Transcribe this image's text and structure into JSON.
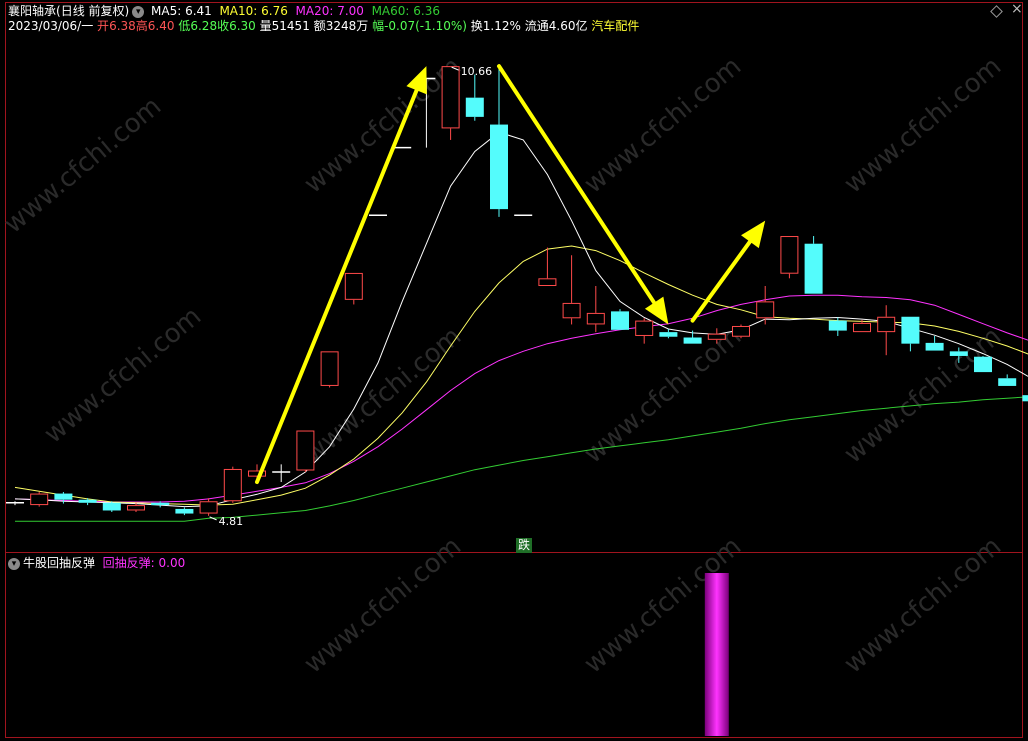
{
  "header": {
    "stock_name": "襄阳轴承",
    "period_label": "(日线 前复权)",
    "ma": [
      {
        "label": "MA5: 6.41",
        "color": "#ffffff"
      },
      {
        "label": "MA10: 6.76",
        "color": "#ffff33"
      },
      {
        "label": "MA20: 7.00",
        "color": "#ff33ff"
      },
      {
        "label": "MA60: 6.36",
        "color": "#33cc33"
      }
    ],
    "date": "2023/03/06/一",
    "open_label": "开",
    "open": "6.38",
    "high_label": "高",
    "high": "6.40",
    "low_label": "低",
    "low": "6.28",
    "close_label": "收",
    "close": "6.30",
    "volume_label": "量",
    "volume": "51451",
    "amount_label": "额",
    "amount": "3248万",
    "change_label": "幅",
    "change": "-0.07(-1.10%)",
    "turnover_label": "换",
    "turnover": "1.12%",
    "float_label": "流通",
    "float_value": "4.60亿",
    "industry": "汽车配件"
  },
  "annotations": {
    "high_marker": "10.66",
    "low_marker": "4.81",
    "signal_label": "跌",
    "watermark": "www.cfchi.com"
  },
  "indicator": {
    "name": "牛股回抽反弹",
    "series_label": "回抽反弹: 0.00",
    "series_color": "#ff33ff"
  },
  "chart_data": {
    "type": "candlestick",
    "price_range": [
      4.6,
      11.0
    ],
    "candles": [
      {
        "o": 4.98,
        "h": 5.0,
        "l": 4.95,
        "c": 4.98
      },
      {
        "o": 4.95,
        "h": 5.12,
        "l": 4.93,
        "c": 5.1
      },
      {
        "o": 5.1,
        "h": 5.12,
        "l": 4.97,
        "c": 5.02
      },
      {
        "o": 5.02,
        "h": 5.04,
        "l": 4.95,
        "c": 4.98
      },
      {
        "o": 4.98,
        "h": 5.0,
        "l": 4.86,
        "c": 4.88
      },
      {
        "o": 4.88,
        "h": 4.98,
        "l": 4.86,
        "c": 4.95
      },
      {
        "o": 4.98,
        "h": 5.0,
        "l": 4.92,
        "c": 4.95
      },
      {
        "o": 4.9,
        "h": 4.92,
        "l": 4.82,
        "c": 4.84
      },
      {
        "o": 4.84,
        "h": 5.04,
        "l": 4.81,
        "c": 5.0
      },
      {
        "o": 5.0,
        "h": 5.45,
        "l": 4.98,
        "c": 5.42
      },
      {
        "o": 5.32,
        "h": 5.48,
        "l": 5.25,
        "c": 5.4
      },
      {
        "o": 5.38,
        "h": 5.48,
        "l": 5.25,
        "c": 5.38
      },
      {
        "o": 5.4,
        "h": 5.92,
        "l": 5.38,
        "c": 5.92
      },
      {
        "o": 6.5,
        "h": 6.95,
        "l": 6.48,
        "c": 6.95
      },
      {
        "o": 7.62,
        "h": 7.97,
        "l": 7.56,
        "c": 7.97
      },
      {
        "o": 8.72,
        "h": 8.72,
        "l": 8.72,
        "c": 8.72
      },
      {
        "o": 9.6,
        "h": 9.6,
        "l": 9.6,
        "c": 9.6
      },
      {
        "o": 10.5,
        "h": 10.5,
        "l": 9.6,
        "c": 10.5
      },
      {
        "o": 9.85,
        "h": 10.66,
        "l": 9.7,
        "c": 10.66
      },
      {
        "o": 10.25,
        "h": 10.55,
        "l": 9.95,
        "c": 10.0
      },
      {
        "o": 9.9,
        "h": 10.66,
        "l": 8.7,
        "c": 8.8
      },
      {
        "o": 8.72,
        "h": 8.72,
        "l": 8.72,
        "c": 8.72
      },
      {
        "o": 7.8,
        "h": 8.3,
        "l": 7.8,
        "c": 7.9
      },
      {
        "o": 7.38,
        "h": 8.2,
        "l": 7.3,
        "c": 7.58
      },
      {
        "o": 7.3,
        "h": 7.8,
        "l": 7.2,
        "c": 7.45
      },
      {
        "o": 7.47,
        "h": 7.5,
        "l": 7.24,
        "c": 7.23
      },
      {
        "o": 7.15,
        "h": 7.38,
        "l": 7.05,
        "c": 7.35
      },
      {
        "o": 7.2,
        "h": 7.24,
        "l": 7.12,
        "c": 7.14
      },
      {
        "o": 7.13,
        "h": 7.22,
        "l": 7.05,
        "c": 7.05
      },
      {
        "o": 7.1,
        "h": 7.25,
        "l": 7.05,
        "c": 7.18
      },
      {
        "o": 7.14,
        "h": 7.3,
        "l": 7.12,
        "c": 7.28
      },
      {
        "o": 7.38,
        "h": 7.8,
        "l": 7.3,
        "c": 7.6
      },
      {
        "o": 7.96,
        "h": 8.45,
        "l": 7.9,
        "c": 8.45
      },
      {
        "o": 8.35,
        "h": 8.45,
        "l": 7.7,
        "c": 7.7
      },
      {
        "o": 7.35,
        "h": 7.39,
        "l": 7.15,
        "c": 7.22
      },
      {
        "o": 7.2,
        "h": 7.36,
        "l": 7.2,
        "c": 7.32
      },
      {
        "o": 7.2,
        "h": 7.55,
        "l": 6.9,
        "c": 7.4
      },
      {
        "o": 7.4,
        "h": 7.4,
        "l": 6.95,
        "c": 7.05
      },
      {
        "o": 7.06,
        "h": 7.15,
        "l": 6.96,
        "c": 6.96
      },
      {
        "o": 6.95,
        "h": 7.0,
        "l": 6.8,
        "c": 6.89
      },
      {
        "o": 6.88,
        "h": 6.89,
        "l": 6.68,
        "c": 6.68
      },
      {
        "o": 6.6,
        "h": 6.65,
        "l": 6.5,
        "c": 6.5
      },
      {
        "o": 6.38,
        "h": 6.4,
        "l": 6.28,
        "c": 6.3
      }
    ],
    "ma5": [
      5.03,
      5.02,
      5.0,
      4.99,
      4.98,
      4.97,
      4.95,
      4.93,
      4.94,
      5.02,
      5.09,
      5.18,
      5.38,
      5.71,
      6.2,
      6.8,
      7.6,
      8.35,
      9.1,
      9.55,
      9.8,
      9.7,
      9.25,
      8.65,
      8.0,
      7.6,
      7.39,
      7.24,
      7.19,
      7.17,
      7.23,
      7.37,
      7.36,
      7.38,
      7.39,
      7.37,
      7.34,
      7.25,
      7.16,
      7.05,
      6.92,
      6.78,
      6.6
    ],
    "ma10": [
      5.18,
      5.13,
      5.08,
      5.03,
      4.99,
      4.98,
      4.97,
      4.96,
      4.95,
      4.96,
      5.02,
      5.08,
      5.17,
      5.34,
      5.55,
      5.82,
      6.15,
      6.55,
      7.02,
      7.47,
      7.84,
      8.12,
      8.28,
      8.32,
      8.26,
      8.13,
      7.97,
      7.82,
      7.68,
      7.56,
      7.49,
      7.4,
      7.38,
      7.37,
      7.35,
      7.34,
      7.33,
      7.32,
      7.28,
      7.21,
      7.12,
      7.02,
      6.9
    ],
    "ma20": [
      5.03,
      5.02,
      5.01,
      5.0,
      4.99,
      4.99,
      4.99,
      5.0,
      5.03,
      5.08,
      5.13,
      5.18,
      5.24,
      5.36,
      5.52,
      5.71,
      5.94,
      6.19,
      6.44,
      6.66,
      6.83,
      6.95,
      7.05,
      7.12,
      7.18,
      7.23,
      7.27,
      7.31,
      7.38,
      7.48,
      7.56,
      7.62,
      7.67,
      7.68,
      7.68,
      7.66,
      7.65,
      7.62,
      7.55,
      7.43,
      7.31,
      7.19,
      7.08
    ],
    "ma60": [
      4.74,
      4.74,
      4.74,
      4.74,
      4.74,
      4.74,
      4.74,
      4.74,
      4.78,
      4.79,
      4.82,
      4.85,
      4.88,
      4.94,
      5.01,
      5.09,
      5.17,
      5.25,
      5.33,
      5.41,
      5.47,
      5.53,
      5.58,
      5.63,
      5.68,
      5.72,
      5.76,
      5.8,
      5.85,
      5.9,
      5.95,
      6.01,
      6.06,
      6.1,
      6.14,
      6.18,
      6.21,
      6.24,
      6.27,
      6.29,
      6.32,
      6.34,
      6.36
    ],
    "trend_arrows": [
      {
        "from": [
          10,
          5.25
        ],
        "to": [
          17,
          10.66
        ]
      },
      {
        "from": [
          20,
          10.66
        ],
        "to": [
          27,
          7.3
        ]
      },
      {
        "from": [
          28,
          7.35
        ],
        "to": [
          31,
          8.65
        ]
      }
    ],
    "indicator_bars": [
      {
        "index": 29,
        "value": 1
      }
    ]
  }
}
